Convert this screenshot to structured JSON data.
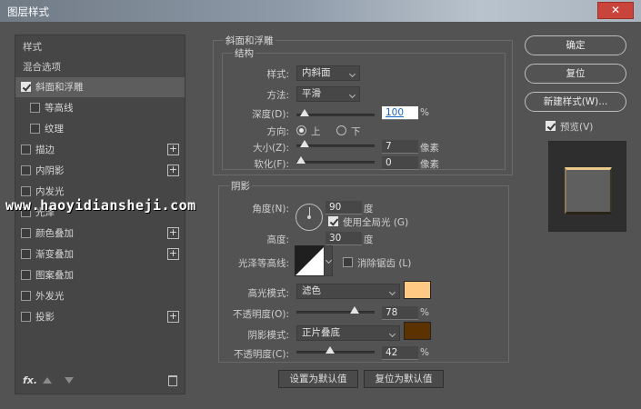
{
  "window": {
    "title": "图层样式",
    "close_label": "✕"
  },
  "left_panel": {
    "header_styles": "样式",
    "header_blend": "混合选项",
    "items": [
      {
        "label": "斜面和浮雕",
        "checked": true,
        "selected": true
      },
      {
        "label": "等高线",
        "checked": false
      },
      {
        "label": "纹理",
        "checked": false
      },
      {
        "label": "描边",
        "checked": false
      },
      {
        "label": "内阴影",
        "checked": false
      },
      {
        "label": "内发光",
        "checked": false
      },
      {
        "label": "光泽",
        "checked": false
      },
      {
        "label": "颜色叠加",
        "checked": false
      },
      {
        "label": "渐变叠加",
        "checked": false
      },
      {
        "label": "图案叠加",
        "checked": false
      },
      {
        "label": "外发光",
        "checked": false
      },
      {
        "label": "投影",
        "checked": false
      }
    ],
    "plus_label": "+",
    "fx_label": "fx."
  },
  "bevel": {
    "section_title": "斜面和浮雕",
    "structure_title": "结构",
    "style_label": "样式:",
    "style_value": "内斜面",
    "technique_label": "方法:",
    "technique_value": "平滑",
    "depth_label": "深度(D):",
    "depth_value": "100",
    "depth_unit": "%",
    "depth_level": 0.05,
    "direction_label": "方向:",
    "direction_up": "上",
    "direction_down": "下",
    "size_label": "大小(Z):",
    "size_value": "7",
    "size_unit": "像素",
    "size_level": 0.05,
    "soften_label": "软化(F):",
    "soften_value": "0",
    "soften_unit": "像素",
    "soften_level": 0.0
  },
  "shading": {
    "section_title": "阴影",
    "angle_label": "角度(N):",
    "angle_value": "90",
    "angle_unit": "度",
    "global_light_label": "使用全局光 (G)",
    "altitude_label": "高度:",
    "altitude_value": "30",
    "altitude_unit": "度",
    "gloss_contour_label": "光泽等高线:",
    "antialias_label": "消除锯齿 (L)",
    "highlight_mode_label": "高光模式:",
    "highlight_mode_value": "滤色",
    "highlight_color": "#ffc983",
    "highlight_opacity_label": "不透明度(O):",
    "highlight_opacity_value": "78",
    "highlight_opacity_unit": "%",
    "highlight_opacity_level": 0.78,
    "shadow_mode_label": "阴影模式:",
    "shadow_mode_value": "正片叠底",
    "shadow_color": "#5c3200",
    "shadow_opacity_label": "不透明度(C):",
    "shadow_opacity_value": "42",
    "shadow_opacity_unit": "%",
    "shadow_opacity_level": 0.42
  },
  "buttons": {
    "make_default": "设置为默认值",
    "reset_default": "复位为默认值",
    "ok": "确定",
    "reset": "复位",
    "new_style": "新建样式(W)...",
    "preview": "预览(V)"
  },
  "watermark": "www.haoyidiansheji.com"
}
